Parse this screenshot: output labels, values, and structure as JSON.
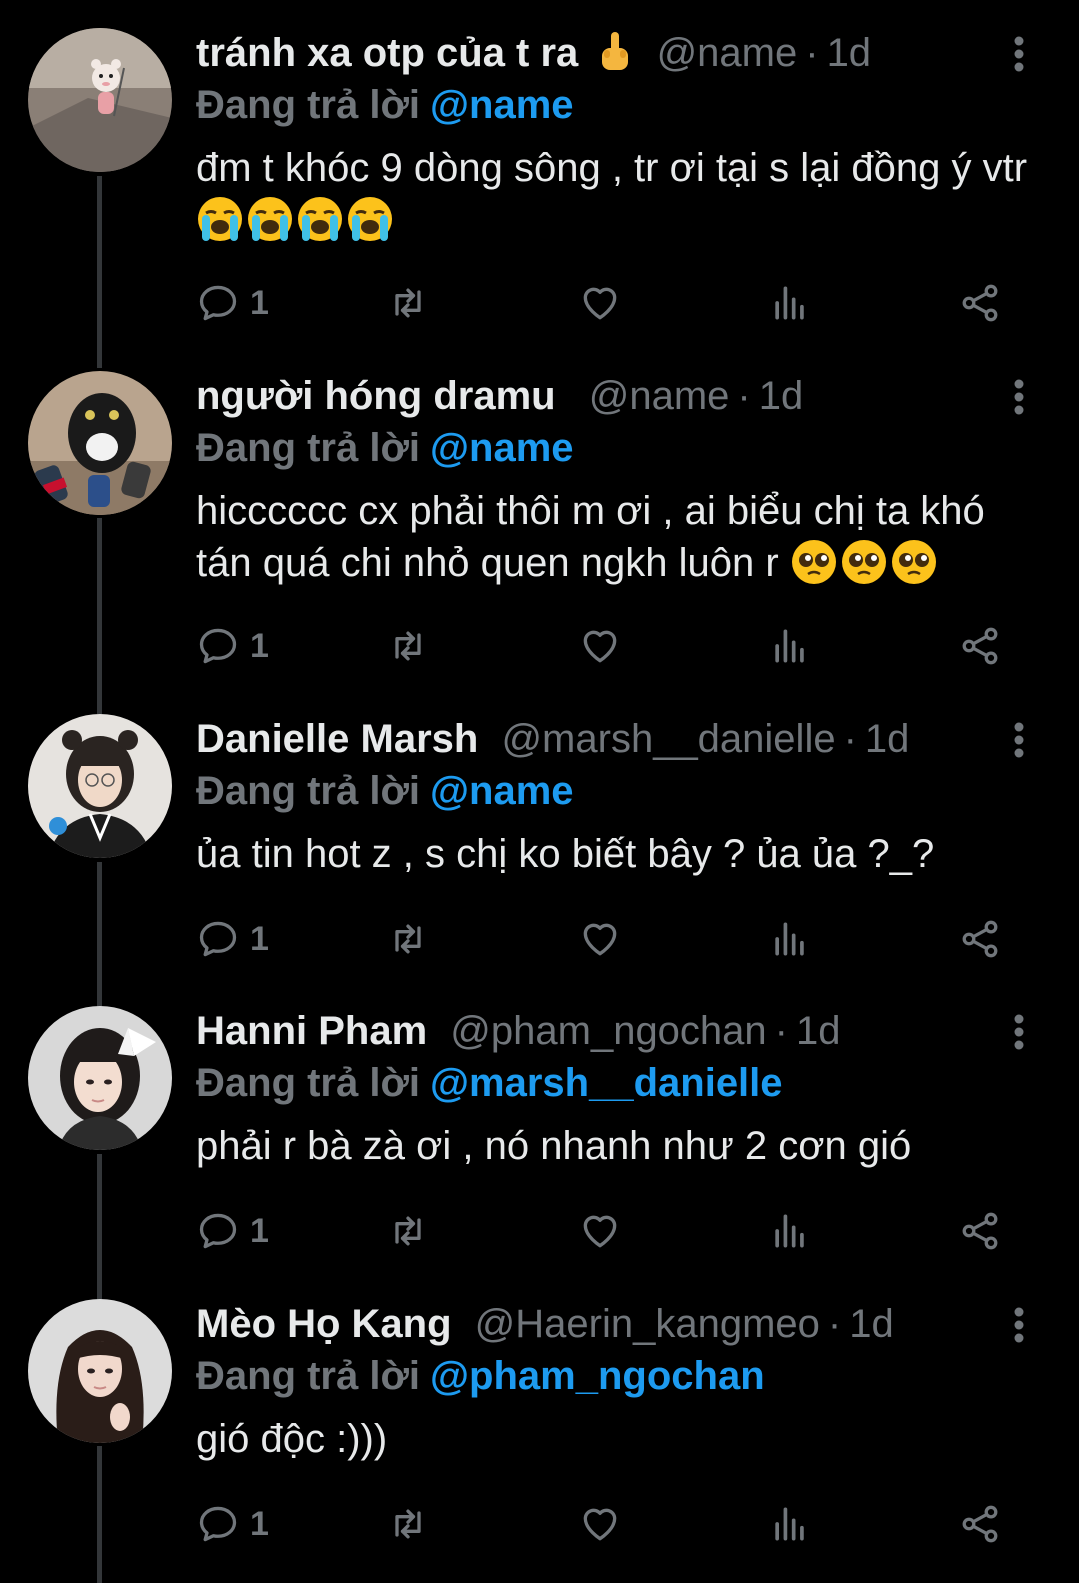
{
  "theme": {
    "background": "#000000",
    "text": "#e7e9ea",
    "muted": "#71767b",
    "accent": "#1d9bf0",
    "thread_line": "#333639"
  },
  "replying_prefix": "Đang trả lời",
  "tweets": [
    {
      "display_name": "tránh xa otp của t ra",
      "name_emoji": "middle-finger-emoji",
      "handle": "@name",
      "time": "1d",
      "replying_to": "@name",
      "text": "đm t khóc 9 dòng sông , tr ơi tại s lại đồng ý vtr",
      "trailing_emoji": [
        "loudly-crying-face",
        "loudly-crying-face",
        "loudly-crying-face",
        "loudly-crying-face"
      ],
      "reply_count": "1"
    },
    {
      "display_name": "người hóng dramu",
      "handle": "@name",
      "time": "1d",
      "replying_to": "@name",
      "text": "hicccccc cx phải thôi m ơi , ai biểu chị ta khó tán quá chi nhỏ quen ngkh luôn r",
      "trailing_emoji": [
        "pleading-face",
        "pleading-face",
        "pleading-face"
      ],
      "reply_count": "1"
    },
    {
      "display_name": "Danielle Marsh",
      "handle": "@marsh__danielle",
      "time": "1d",
      "replying_to": "@name",
      "text": "ủa tin hot z , s chị ko biết bây ? ủa ủa ?_?",
      "trailing_emoji": [],
      "reply_count": "1"
    },
    {
      "display_name": "Hanni Pham",
      "handle": "@pham_ngochan",
      "time": "1d",
      "replying_to": "@marsh__danielle",
      "text": "phải r bà zà ơi , nó nhanh như 2 cơn gió",
      "trailing_emoji": [],
      "reply_count": "1"
    },
    {
      "display_name": "Mèo Họ Kang",
      "handle": "@Haerin_kangmeo",
      "time": "1d",
      "replying_to": "@pham_ngochan",
      "text": "gió độc :)))",
      "trailing_emoji": [],
      "reply_count": "1"
    }
  ],
  "action_icons": [
    "reply-icon",
    "retweet-icon",
    "like-icon",
    "views-icon",
    "share-icon"
  ]
}
